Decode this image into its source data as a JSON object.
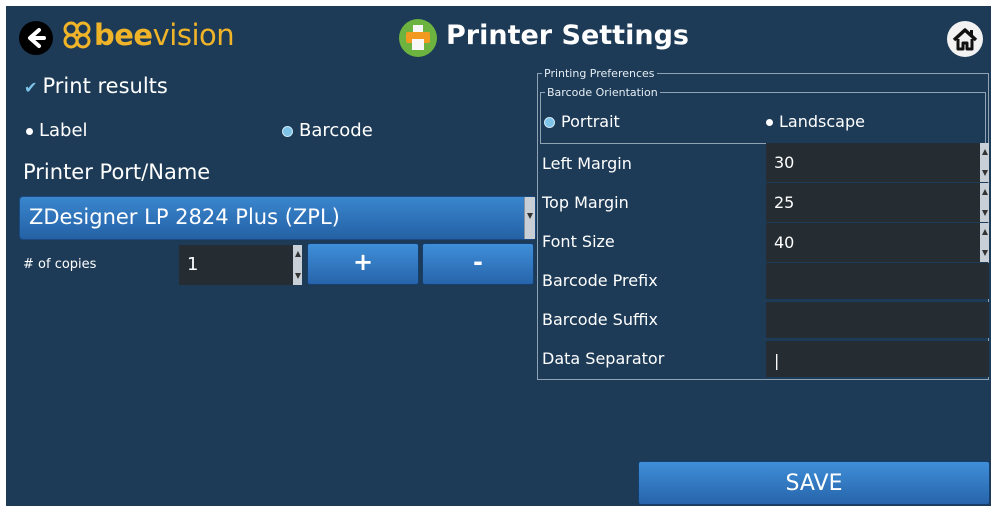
{
  "header": {
    "logo_text_bold": "bee",
    "logo_text_light": "vision",
    "title": "Printer Settings"
  },
  "left": {
    "print_results_label": "Print results",
    "print_results_checked": true,
    "mode_options": [
      {
        "label": "Label",
        "selected": false
      },
      {
        "label": "Barcode",
        "selected": true
      }
    ],
    "printer_port_label": "Printer Port/Name",
    "printer_selected": "ZDesigner LP 2824 Plus (ZPL)",
    "copies_label": "# of copies",
    "copies_value": "1",
    "plus_label": "+",
    "minus_label": "-"
  },
  "preferences": {
    "legend": "Printing Preferences",
    "orientation_legend": "Barcode Orientation",
    "orientation_options": [
      {
        "label": "Portrait",
        "selected": true
      },
      {
        "label": "Landscape",
        "selected": false
      }
    ],
    "fields": [
      {
        "label": "Left Margin",
        "value": "30"
      },
      {
        "label": "Top Margin",
        "value": "25"
      },
      {
        "label": "Font Size",
        "value": "40"
      },
      {
        "label": "Barcode Prefix",
        "value": ""
      },
      {
        "label": "Barcode Suffix",
        "value": ""
      },
      {
        "label": "Data Separator",
        "value": "|"
      }
    ]
  },
  "save_label": "SAVE",
  "colors": {
    "background": "#1d3b57",
    "brand_orange": "#f0b429",
    "button_blue": "#2f7bc4",
    "input_dark": "#252d33",
    "radio_accent": "#7ec3e8"
  }
}
